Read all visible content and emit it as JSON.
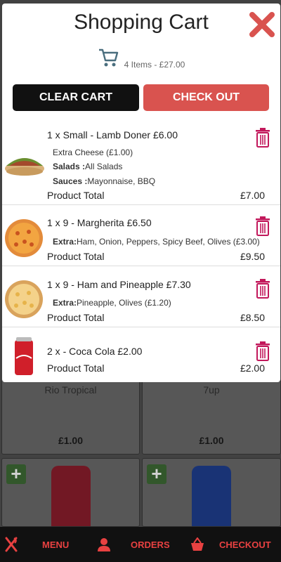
{
  "background_menu": {
    "items": [
      {
        "name": "Rio Tropical",
        "price": "£1.00"
      },
      {
        "name": "7up",
        "price": "£1.00"
      }
    ]
  },
  "modal": {
    "title": "Shopping Cart",
    "summary": "4 Items - £27.00",
    "clear_label": "CLEAR CART",
    "checkout_label": "CHECK OUT",
    "product_total_label": "Product Total",
    "items": [
      {
        "line": "1 x Small - Lamb Doner £6.00",
        "extra_plain": "Extra Cheese (£1.00)",
        "salads_label": "Salads :",
        "salads_value": "All Salads",
        "sauces_label": "Sauces :",
        "sauces_value": "Mayonnaise, BBQ",
        "total": "£7.00",
        "image": "kebab-wrap"
      },
      {
        "line": "1 x 9 - Margherita £6.50",
        "extra_label": "Extra:",
        "extra_value": "Ham, Onion, Peppers, Spicy Beef, Olives (£3.00)",
        "total": "£9.50",
        "image": "pizza"
      },
      {
        "line": "1 x 9 - Ham and Pineapple £7.30",
        "extra_label": "Extra:",
        "extra_value": "Pineapple, Olives (£1.20)",
        "total": "£8.50",
        "image": "pizza"
      },
      {
        "line": "2 x - Coca Cola £2.00",
        "total": "£2.00",
        "image": "coca-cola-can"
      }
    ]
  },
  "nav": {
    "menu_label": "MENU",
    "orders_label": "ORDERS",
    "checkout_label": "CHECKOUT"
  },
  "colors": {
    "accent_red": "#d9534f",
    "trash_magenta": "#c2185b",
    "cart_icon": "#4a6e7e"
  }
}
